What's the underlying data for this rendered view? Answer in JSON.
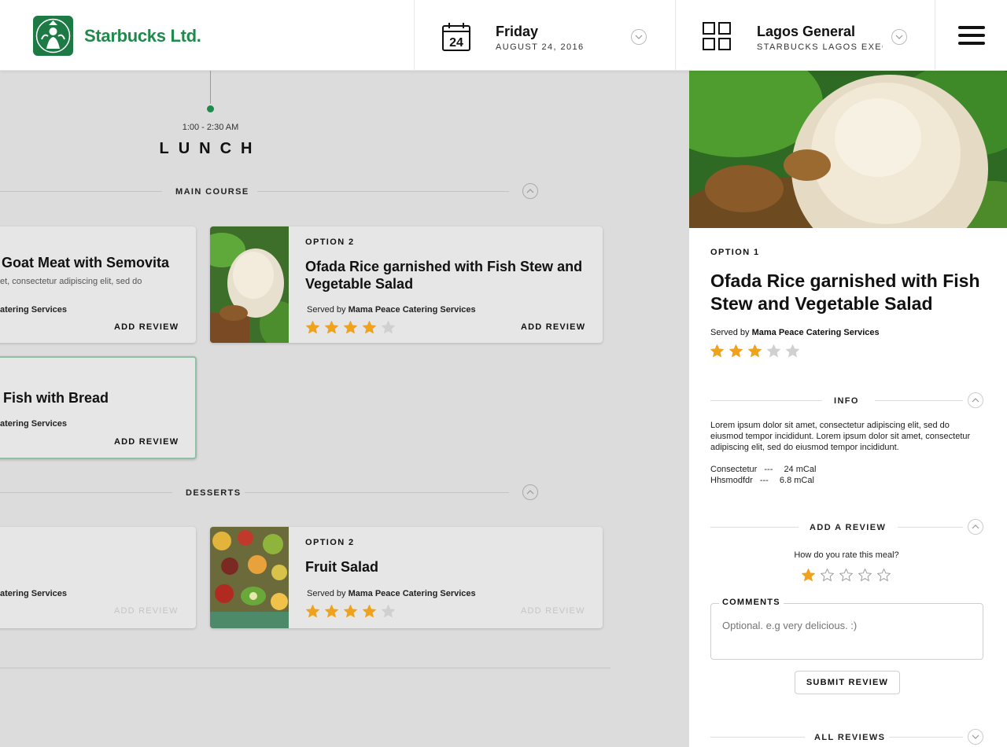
{
  "header": {
    "brand_name": "Starbucks Ltd.",
    "date": {
      "day": "Friday",
      "full": "AUGUST 24, 2016",
      "calendar_day": "24"
    },
    "location": {
      "name": "Lagos General",
      "sub": "STARBUCKS LAGOS EXECU"
    }
  },
  "timeline": {
    "time": "1:00 - 2:30 AM",
    "meal": "LUNCH"
  },
  "sections": {
    "main_course": "MAIN COURSE",
    "desserts": "DESSERTS"
  },
  "cards": {
    "mc1": {
      "title": "Goat Meat with Semovita",
      "desc": "et, consectetur adipiscing elit, sed do",
      "caterer": "atering Services",
      "add_review": "ADD REVIEW"
    },
    "mc2": {
      "option": "OPTION 2",
      "title": "Ofada Rice garnished with Fish Stew and Vegetable Salad",
      "served_by": "Served by",
      "caterer": "Mama Peace Catering Services",
      "add_review": "ADD REVIEW",
      "rating": 4
    },
    "mc3": {
      "title": "Fish with Bread",
      "caterer": "atering Services",
      "add_review": "ADD REVIEW"
    },
    "d1": {
      "caterer": "atering Services",
      "add_review": "ADD REVIEW"
    },
    "d2": {
      "option": "OPTION 2",
      "title": "Fruit Salad",
      "served_by": "Served by",
      "caterer": "Mama Peace Catering Services",
      "add_review": "ADD REVIEW",
      "rating": 4
    }
  },
  "panel": {
    "option": "OPTION 1",
    "title": "Ofada Rice garnished with Fish Stew and Vegetable Salad",
    "served_by": "Served by",
    "caterer": "Mama Peace Catering Services",
    "rating": 3,
    "info_label": "INFO",
    "info_text": "Lorem ipsum dolor sit amet, consectetur adipiscing elit, sed do eiusmod tempor incididunt. Lorem ipsum dolor sit amet, consectetur adipiscing elit, sed do eiusmod tempor incididunt.",
    "nutrition": [
      {
        "name": "Consectetur",
        "sep": "---",
        "value": "24 mCal"
      },
      {
        "name": "Hhsmodfdr",
        "sep": "---",
        "value": "6.8 mCal"
      }
    ],
    "add_review_label": "ADD A REVIEW",
    "rate_question": "How do you rate this meal?",
    "user_rating": 1,
    "comments_label": "COMMENTS",
    "comments_placeholder": "Optional. e.g very delicious. :)",
    "submit_label": "SUBMIT REVIEW",
    "all_reviews_label": "ALL REVIEWS"
  },
  "colors": {
    "brand": "#1e8a4c",
    "star_filled": "#f0a21c",
    "star_empty": "#d0d0d0",
    "page_bg": "#dcdcdc"
  },
  "icons": [
    "starbucks-logo",
    "calendar-icon",
    "grid-icon",
    "hamburger-icon",
    "chevron-down-icon",
    "chevron-up-icon",
    "star-icon"
  ]
}
